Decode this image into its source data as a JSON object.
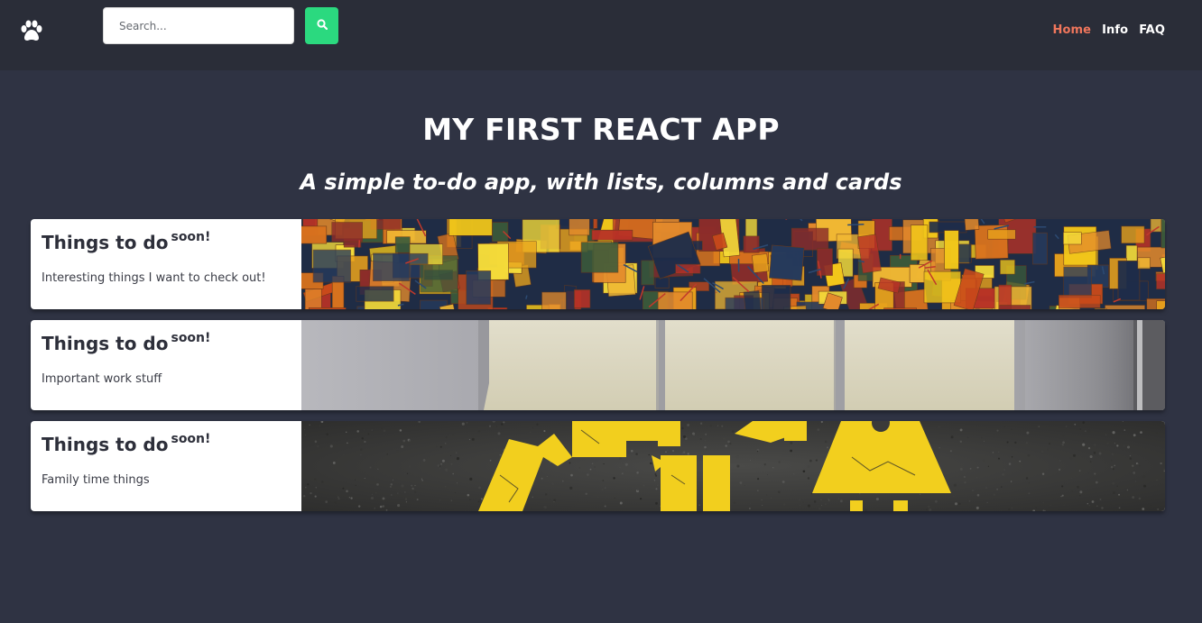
{
  "header": {
    "logo_icon": "paw-icon",
    "search": {
      "placeholder": "Search...",
      "value": "",
      "button_icon": "search-icon"
    },
    "nav": [
      {
        "label": "Home",
        "active": true
      },
      {
        "label": "Info",
        "active": false
      },
      {
        "label": "FAQ",
        "active": false
      }
    ]
  },
  "hero": {
    "title": "MY FIRST REACT APP",
    "subtitle": "A simple to-do app, with lists, columns and cards"
  },
  "lists": [
    {
      "title": "Things to do",
      "title_suffix": "soon!",
      "description": "Interesting things I want to check out!",
      "image": "colorful-abstract-mosaic"
    },
    {
      "title": "Things to do",
      "title_suffix": "soon!",
      "description": "Important work stuff",
      "image": "sticky-notes-on-wall"
    },
    {
      "title": "Things to do",
      "title_suffix": "soon!",
      "description": "Family time things",
      "image": "painted-family-figures-on-asphalt"
    }
  ],
  "colors": {
    "background": "#2f3343",
    "header": "#2a2d38",
    "accent_nav_active": "#f0765c",
    "search_button": "#2bd97f"
  }
}
